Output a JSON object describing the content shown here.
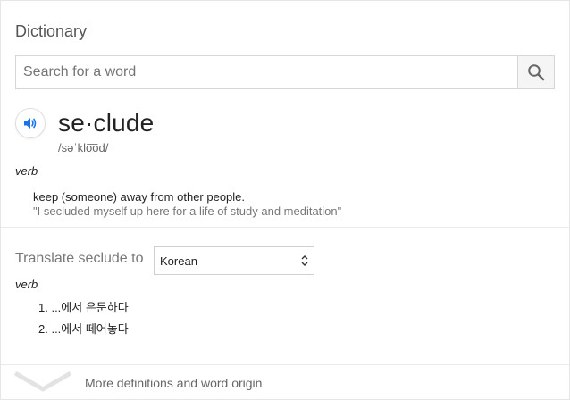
{
  "header": {
    "title": "Dictionary"
  },
  "search": {
    "placeholder": "Search for a word",
    "value": "",
    "button_icon": "search-icon"
  },
  "entry": {
    "word": "se·clude",
    "phonetic": "/səˈklo͞od/",
    "audio_icon": "speaker-icon",
    "part_of_speech": "verb",
    "definitions": [
      {
        "text": "keep (someone) away from other people.",
        "example": "\"I secluded myself up here for a life of study and meditation\""
      }
    ]
  },
  "translate": {
    "label": "Translate seclude to",
    "selected_language": "Korean",
    "part_of_speech": "verb",
    "items": [
      "1. ...에서 은둔하다",
      "2. ...에서 떼어놓다"
    ]
  },
  "footer": {
    "more_label": "More definitions and word origin",
    "chevron_icon": "chevron-down-icon"
  },
  "colors": {
    "accent": "#1a73e8",
    "text": "#222222",
    "muted": "#777777",
    "border": "#d6d6d6"
  }
}
